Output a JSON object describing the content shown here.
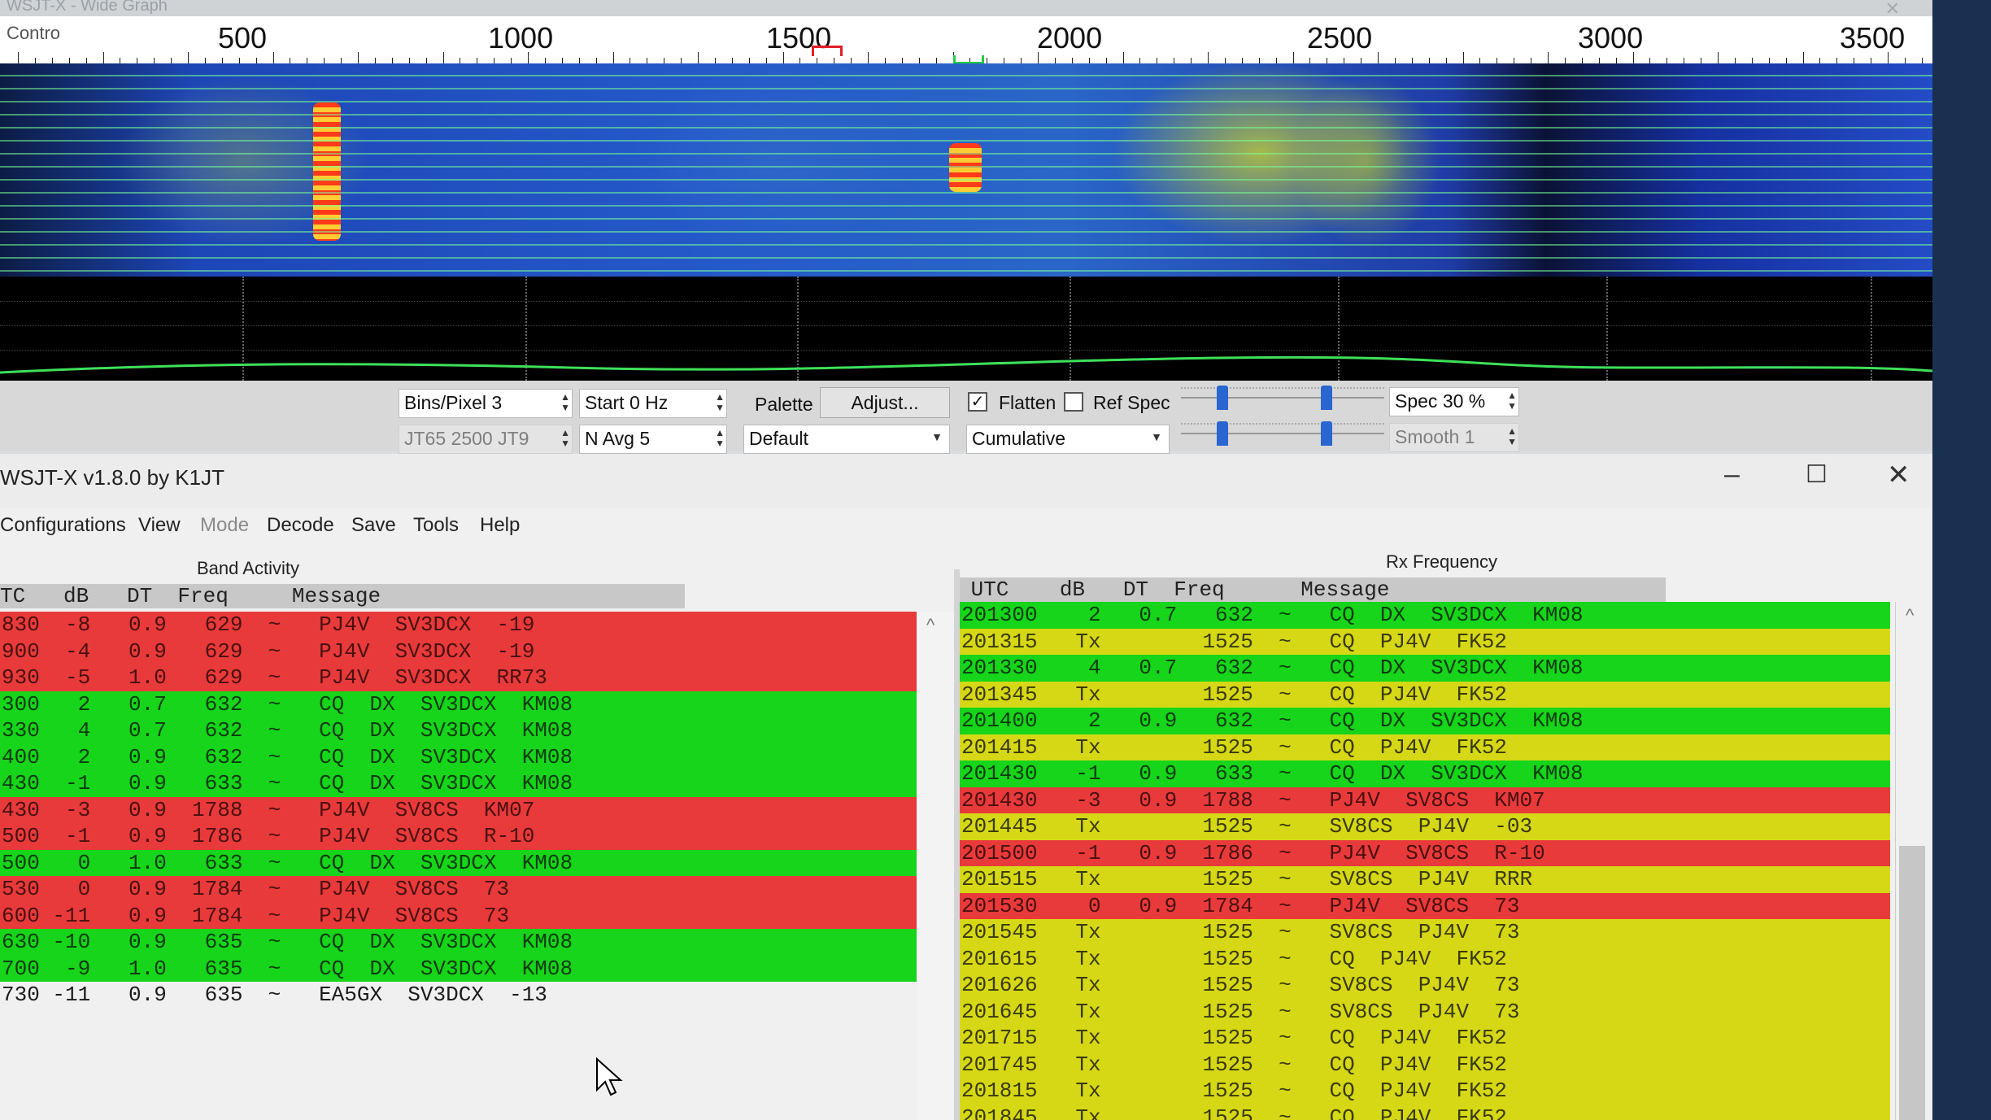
{
  "wide_graph": {
    "title": "WSJT-X - Wide Graph",
    "control_label": "Contro",
    "scale_labels": [
      "500",
      "1000",
      "1500",
      "2000",
      "2500",
      "3000",
      "3500"
    ],
    "bins_pixel": "Bins/Pixel  3",
    "start_hz": "Start 0 Hz",
    "jt65_field": "JT65  2500  JT9",
    "n_avg": "N Avg 5",
    "palette_label": "Palette",
    "adjust_button": "Adjust...",
    "palette_value": "Default",
    "flatten_label": "Flatten",
    "flatten_checked": true,
    "ref_spec_label": "Ref Spec",
    "ref_spec_checked": false,
    "cumulative_value": "Cumulative",
    "spec_value": "Spec 30 %",
    "smooth_value": "Smooth  1"
  },
  "main": {
    "title": "WSJT-X   v1.8.0   by K1JT",
    "menu": [
      "Configurations",
      "View",
      "Mode",
      "Decode",
      "Save",
      "Tools",
      "Help"
    ],
    "band_activity": {
      "title": "Band Activity",
      "header": "TC   dB   DT  Freq     Message",
      "rows": [
        {
          "text": "830  -8   0.9   629  ~   PJ4V  SV3DCX  -19",
          "color": "red"
        },
        {
          "text": "900  -4   0.9   629  ~   PJ4V  SV3DCX  -19",
          "color": "red"
        },
        {
          "text": "930  -5   1.0   629  ~   PJ4V  SV3DCX  RR73",
          "color": "red"
        },
        {
          "text": "300   2   0.7   632  ~   CQ  DX  SV3DCX  KM08",
          "color": "green"
        },
        {
          "text": "330   4   0.7   632  ~   CQ  DX  SV3DCX  KM08",
          "color": "green"
        },
        {
          "text": "400   2   0.9   632  ~   CQ  DX  SV3DCX  KM08",
          "color": "green"
        },
        {
          "text": "430  -1   0.9   633  ~   CQ  DX  SV3DCX  KM08",
          "color": "green"
        },
        {
          "text": "430  -3   0.9  1788  ~   PJ4V  SV8CS  KM07",
          "color": "red"
        },
        {
          "text": "500  -1   0.9  1786  ~   PJ4V  SV8CS  R-10",
          "color": "red"
        },
        {
          "text": "500   0   1.0   633  ~   CQ  DX  SV3DCX  KM08",
          "color": "green"
        },
        {
          "text": "530   0   0.9  1784  ~   PJ4V  SV8CS  73",
          "color": "red"
        },
        {
          "text": "600 -11   0.9  1784  ~   PJ4V  SV8CS  73",
          "color": "red"
        },
        {
          "text": "630 -10   0.9   635  ~   CQ  DX  SV3DCX  KM08",
          "color": "green"
        },
        {
          "text": "700  -9   1.0   635  ~   CQ  DX  SV3DCX  KM08",
          "color": "green"
        },
        {
          "text": "730 -11   0.9   635  ~   EA5GX  SV3DCX  -13",
          "color": "none"
        }
      ]
    },
    "rx_frequency": {
      "title": "Rx Frequency",
      "header": " UTC    dB   DT  Freq      Message",
      "rows": [
        {
          "text": "201300    2   0.7   632  ~   CQ  DX  SV3DCX  KM08",
          "color": "green"
        },
        {
          "text": "201315   Tx        1525  ~   CQ  PJ4V  FK52",
          "color": "yellow"
        },
        {
          "text": "201330    4   0.7   632  ~   CQ  DX  SV3DCX  KM08",
          "color": "green"
        },
        {
          "text": "201345   Tx        1525  ~   CQ  PJ4V  FK52",
          "color": "yellow"
        },
        {
          "text": "201400    2   0.9   632  ~   CQ  DX  SV3DCX  KM08",
          "color": "green"
        },
        {
          "text": "201415   Tx        1525  ~   CQ  PJ4V  FK52",
          "color": "yellow"
        },
        {
          "text": "201430   -1   0.9   633  ~   CQ  DX  SV3DCX  KM08",
          "color": "green"
        },
        {
          "text": "201430   -3   0.9  1788  ~   PJ4V  SV8CS  KM07",
          "color": "red"
        },
        {
          "text": "201445   Tx        1525  ~   SV8CS  PJ4V  -03",
          "color": "yellow"
        },
        {
          "text": "201500   -1   0.9  1786  ~   PJ4V  SV8CS  R-10",
          "color": "red"
        },
        {
          "text": "201515   Tx        1525  ~   SV8CS  PJ4V  RRR",
          "color": "yellow"
        },
        {
          "text": "201530    0   0.9  1784  ~   PJ4V  SV8CS  73",
          "color": "red"
        },
        {
          "text": "201545   Tx        1525  ~   SV8CS  PJ4V  73",
          "color": "yellow"
        },
        {
          "text": "201615   Tx        1525  ~   CQ  PJ4V  FK52",
          "color": "yellow"
        },
        {
          "text": "201626   Tx        1525  ~   SV8CS  PJ4V  73",
          "color": "yellow"
        },
        {
          "text": "201645   Tx        1525  ~   SV8CS  PJ4V  73",
          "color": "yellow"
        },
        {
          "text": "201715   Tx        1525  ~   CQ  PJ4V  FK52",
          "color": "yellow"
        },
        {
          "text": "201745   Tx        1525  ~   CQ  PJ4V  FK52",
          "color": "yellow"
        },
        {
          "text": "201815   Tx        1525  ~   CQ  PJ4V  FK52",
          "color": "yellow"
        },
        {
          "text": "201845   Tx        1525  ~   CQ  PJ4V  FK52",
          "color": "yellow"
        }
      ]
    }
  },
  "colors": {
    "red": "#e83a3a",
    "green": "#16d51a",
    "yellow": "#d6d816"
  }
}
